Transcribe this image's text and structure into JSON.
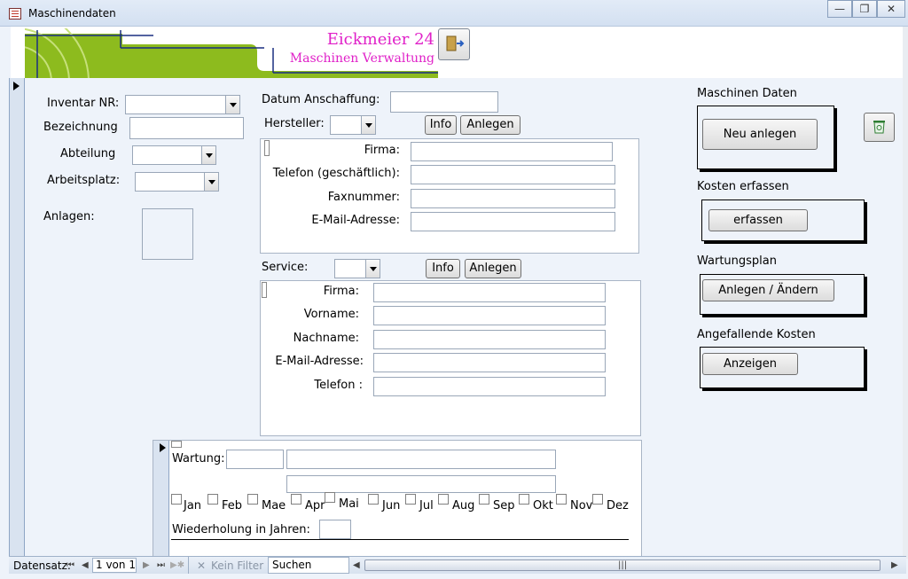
{
  "window": {
    "title": "Maschinendaten"
  },
  "header": {
    "title": "Eickmeier 24",
    "subtitle": "Maschinen Verwaltung"
  },
  "left": {
    "inventar_label": "Inventar NR:",
    "bezeichnung_label": "Bezeichnung",
    "abteilung_label": "Abteilung",
    "arbeitsplatz_label": "Arbeitsplatz:",
    "anlagen_label": "Anlagen:"
  },
  "middle": {
    "datum_label": "Datum Anschaffung:",
    "hersteller_label": "Hersteller:",
    "info_label": "Info",
    "anlegen_label": "Anlegen",
    "service_label": "Service:",
    "hersteller_fields": [
      "Firma:",
      "Telefon (geschäftlich):",
      "Faxnummer:",
      "E-Mail-Adresse:"
    ],
    "service_fields": [
      "Firma:",
      "Vorname:",
      "Nachname:",
      "E-Mail-Adresse:",
      "Telefon :"
    ]
  },
  "wartung": {
    "label": "Wartung:",
    "months": [
      "Jan",
      "Feb",
      "Mae",
      "Apr",
      "Mai",
      "Jun",
      "Jul",
      "Aug",
      "Sep",
      "Okt",
      "Nov",
      "Dez"
    ],
    "wiederholung_label": "Wiederholung in Jahren:"
  },
  "right": {
    "maschinen_label": "Maschinen Daten",
    "neu_anlegen": "Neu anlegen",
    "kosten_label": "Kosten erfassen",
    "erfassen": "erfassen",
    "wartungsplan_label": "Wartungsplan",
    "anlegen_aendern": "Anlegen / Ändern",
    "angefallende_label": "Angefallende Kosten",
    "anzeigen": "Anzeigen"
  },
  "navbar": {
    "datensatz": "Datensatz:",
    "position": "1 von 1",
    "kein_filter": "Kein Filter",
    "suchen": "Suchen"
  }
}
